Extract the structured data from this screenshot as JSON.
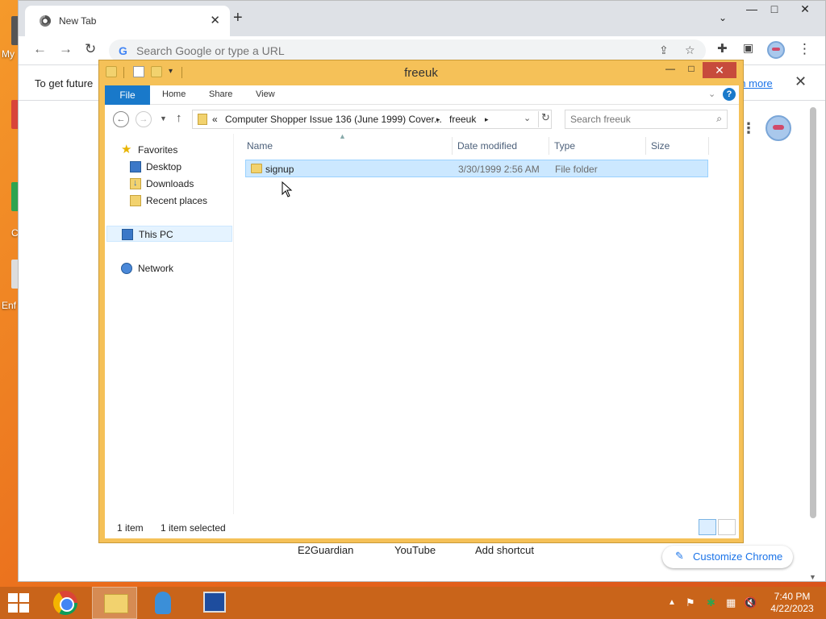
{
  "desktop": {
    "icon_labels": [
      "My",
      "C",
      "Enf"
    ]
  },
  "chrome": {
    "tab_title": "New Tab",
    "omnibox_placeholder": "Search Google or type a URL",
    "infobar_message": "To get future",
    "infobar_link": "rn more",
    "shortcuts": [
      "E2Guardian",
      "YouTube",
      "Add shortcut"
    ],
    "customize_label": "Customize Chrome"
  },
  "explorer": {
    "title": "freeuk",
    "ribbon_tabs": [
      "File",
      "Home",
      "Share",
      "View"
    ],
    "breadcrumb": {
      "prefix": "«",
      "parts": [
        "Computer Shopper Issue 136 (June 1999) Cover...",
        "freeuk"
      ]
    },
    "search_placeholder": "Search freeuk",
    "nav_pane": {
      "favorites": "Favorites",
      "desktop": "Desktop",
      "downloads": "Downloads",
      "recent_places": "Recent places",
      "this_pc": "This PC",
      "network": "Network"
    },
    "columns": [
      "Name",
      "Date modified",
      "Type",
      "Size"
    ],
    "rows": [
      {
        "name": "signup",
        "date_modified": "3/30/1999 2:56 AM",
        "type": "File folder",
        "size": ""
      }
    ],
    "status": {
      "item_count": "1 item",
      "selected": "1 item selected"
    }
  },
  "taskbar": {
    "time": "7:40 PM",
    "date": "4/22/2023"
  }
}
